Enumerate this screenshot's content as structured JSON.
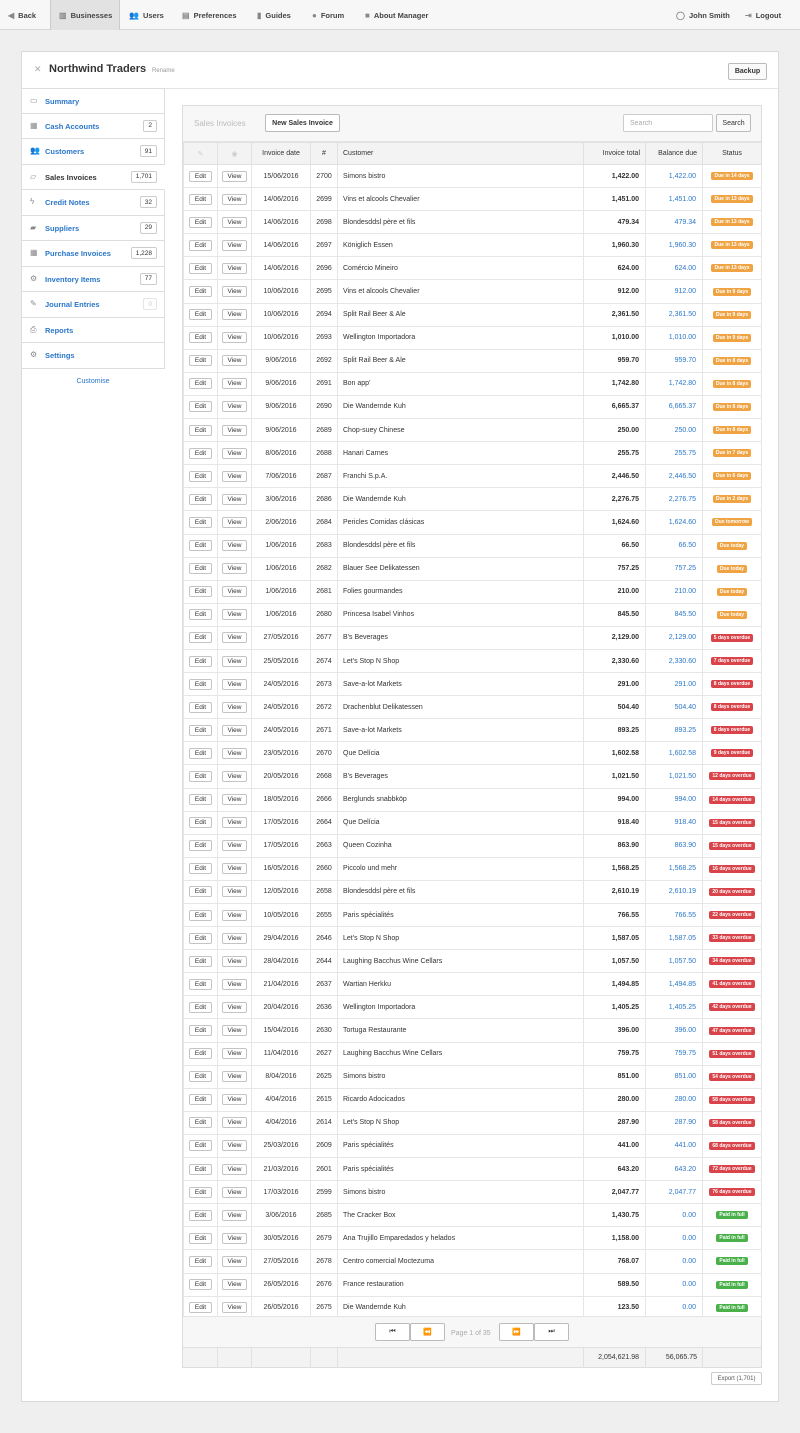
{
  "nav": {
    "back": "Back",
    "businesses": "Businesses",
    "users": "Users",
    "preferences": "Preferences",
    "guides": "Guides",
    "forum": "Forum",
    "about": "About Manager",
    "user": "John Smith",
    "logout": "Logout"
  },
  "business": {
    "name": "Northwind Traders",
    "rename": "Rename",
    "backup": "Backup"
  },
  "sidebar": {
    "items": [
      {
        "label": "Summary",
        "count": "",
        "icon": "monitor-icon"
      },
      {
        "label": "Cash Accounts",
        "count": "2",
        "icon": "cash-icon"
      },
      {
        "label": "Customers",
        "count": "91",
        "icon": "people-icon"
      },
      {
        "label": "Sales Invoices",
        "count": "1,701",
        "icon": "inbox-icon"
      },
      {
        "label": "Credit Notes",
        "count": "32",
        "icon": "bolt-icon"
      },
      {
        "label": "Suppliers",
        "count": "29",
        "icon": "truck-icon"
      },
      {
        "label": "Purchase Invoices",
        "count": "1,228",
        "icon": "calendar-icon"
      },
      {
        "label": "Inventory Items",
        "count": "77",
        "icon": "gears-icon"
      },
      {
        "label": "Journal Entries",
        "count": "0",
        "icon": "pen-icon"
      },
      {
        "label": "Reports",
        "count": "",
        "icon": "printer-icon"
      },
      {
        "label": "Settings",
        "count": "",
        "icon": "gear-icon"
      }
    ],
    "customise": "Customise"
  },
  "invoices": {
    "title": "Sales Invoices",
    "new_button": "New Sales Invoice",
    "search_placeholder": "Search",
    "search_button": "Search",
    "columns": {
      "date": "Invoice date",
      "num": "#",
      "customer": "Customer",
      "total": "Invoice total",
      "balance": "Balance due",
      "status": "Status"
    },
    "edit_label": "Edit",
    "view_label": "View",
    "rows": [
      [
        "15/06/2016",
        "2700",
        "Simons bistro",
        "1,422.00",
        "1,422.00",
        "Due in 14 days",
        "due"
      ],
      [
        "14/06/2016",
        "2699",
        "Vins et alcools Chevalier",
        "1,451.00",
        "1,451.00",
        "Due in 13 days",
        "due"
      ],
      [
        "14/06/2016",
        "2698",
        "Blondesddsl père et fils",
        "479.34",
        "479.34",
        "Due in 13 days",
        "due"
      ],
      [
        "14/06/2016",
        "2697",
        "Königlich Essen",
        "1,960.30",
        "1,960.30",
        "Due in 13 days",
        "due"
      ],
      [
        "14/06/2016",
        "2696",
        "Comércio Mineiro",
        "624.00",
        "624.00",
        "Due in 13 days",
        "due"
      ],
      [
        "10/06/2016",
        "2695",
        "Vins et alcools Chevalier",
        "912.00",
        "912.00",
        "Due in 9 days",
        "due"
      ],
      [
        "10/06/2016",
        "2694",
        "Split Rail Beer & Ale",
        "2,361.50",
        "2,361.50",
        "Due in 9 days",
        "due"
      ],
      [
        "10/06/2016",
        "2693",
        "Wellington Importadora",
        "1,010.00",
        "1,010.00",
        "Due in 9 days",
        "due"
      ],
      [
        "9/06/2016",
        "2692",
        "Split Rail Beer & Ale",
        "959.70",
        "959.70",
        "Due in 8 days",
        "due"
      ],
      [
        "9/06/2016",
        "2691",
        "Bon app'",
        "1,742.80",
        "1,742.80",
        "Due in 8 days",
        "due"
      ],
      [
        "9/06/2016",
        "2690",
        "Die Wandernde Kuh",
        "6,665.37",
        "6,665.37",
        "Due in 8 days",
        "due"
      ],
      [
        "9/06/2016",
        "2689",
        "Chop-suey Chinese",
        "250.00",
        "250.00",
        "Due in 8 days",
        "due"
      ],
      [
        "8/06/2016",
        "2688",
        "Hanari Carnes",
        "255.75",
        "255.75",
        "Due in 7 days",
        "due"
      ],
      [
        "7/06/2016",
        "2687",
        "Franchi S.p.A.",
        "2,446.50",
        "2,446.50",
        "Due in 6 days",
        "due"
      ],
      [
        "3/06/2016",
        "2686",
        "Die Wandernde Kuh",
        "2,276.75",
        "2,276.75",
        "Due in 2 days",
        "due"
      ],
      [
        "2/06/2016",
        "2684",
        "Pericles Comidas clásicas",
        "1,624.60",
        "1,624.60",
        "Due tomorrow",
        "due"
      ],
      [
        "1/06/2016",
        "2683",
        "Blondesddsl père et fils",
        "66.50",
        "66.50",
        "Due today",
        "due"
      ],
      [
        "1/06/2016",
        "2682",
        "Blauer See Delikatessen",
        "757.25",
        "757.25",
        "Due today",
        "due"
      ],
      [
        "1/06/2016",
        "2681",
        "Folies gourmandes",
        "210.00",
        "210.00",
        "Due today",
        "due"
      ],
      [
        "1/06/2016",
        "2680",
        "Princesa Isabel Vinhos",
        "845.50",
        "845.50",
        "Due today",
        "due"
      ],
      [
        "27/05/2016",
        "2677",
        "B's Beverages",
        "2,129.00",
        "2,129.00",
        "5 days overdue",
        "overdue"
      ],
      [
        "25/05/2016",
        "2674",
        "Let's Stop N Shop",
        "2,330.60",
        "2,330.60",
        "7 days overdue",
        "overdue"
      ],
      [
        "24/05/2016",
        "2673",
        "Save-a-lot Markets",
        "291.00",
        "291.00",
        "8 days overdue",
        "overdue"
      ],
      [
        "24/05/2016",
        "2672",
        "Drachenblut Delikatessen",
        "504.40",
        "504.40",
        "8 days overdue",
        "overdue"
      ],
      [
        "24/05/2016",
        "2671",
        "Save-a-lot Markets",
        "893.25",
        "893.25",
        "8 days overdue",
        "overdue"
      ],
      [
        "23/05/2016",
        "2670",
        "Que Delícia",
        "1,602.58",
        "1,602.58",
        "9 days overdue",
        "overdue"
      ],
      [
        "20/05/2016",
        "2668",
        "B's Beverages",
        "1,021.50",
        "1,021.50",
        "12 days overdue",
        "overdue"
      ],
      [
        "18/05/2016",
        "2666",
        "Berglunds snabbköp",
        "994.00",
        "994.00",
        "14 days overdue",
        "overdue"
      ],
      [
        "17/05/2016",
        "2664",
        "Que Delícia",
        "918.40",
        "918.40",
        "15 days overdue",
        "overdue"
      ],
      [
        "17/05/2016",
        "2663",
        "Queen Cozinha",
        "863.90",
        "863.90",
        "15 days overdue",
        "overdue"
      ],
      [
        "16/05/2016",
        "2660",
        "Piccolo und mehr",
        "1,568.25",
        "1,568.25",
        "16 days overdue",
        "overdue"
      ],
      [
        "12/05/2016",
        "2658",
        "Blondesddsl père et fils",
        "2,610.19",
        "2,610.19",
        "20 days overdue",
        "overdue"
      ],
      [
        "10/05/2016",
        "2655",
        "Paris spécialités",
        "766.55",
        "766.55",
        "22 days overdue",
        "overdue"
      ],
      [
        "29/04/2016",
        "2646",
        "Let's Stop N Shop",
        "1,587.05",
        "1,587.05",
        "33 days overdue",
        "overdue"
      ],
      [
        "28/04/2016",
        "2644",
        "Laughing Bacchus Wine Cellars",
        "1,057.50",
        "1,057.50",
        "34 days overdue",
        "overdue"
      ],
      [
        "21/04/2016",
        "2637",
        "Wartian Herkku",
        "1,494.85",
        "1,494.85",
        "41 days overdue",
        "overdue"
      ],
      [
        "20/04/2016",
        "2636",
        "Wellington Importadora",
        "1,405.25",
        "1,405.25",
        "42 days overdue",
        "overdue"
      ],
      [
        "15/04/2016",
        "2630",
        "Tortuga Restaurante",
        "396.00",
        "396.00",
        "47 days overdue",
        "overdue"
      ],
      [
        "11/04/2016",
        "2627",
        "Laughing Bacchus Wine Cellars",
        "759.75",
        "759.75",
        "51 days overdue",
        "overdue"
      ],
      [
        "8/04/2016",
        "2625",
        "Simons bistro",
        "851.00",
        "851.00",
        "54 days overdue",
        "overdue"
      ],
      [
        "4/04/2016",
        "2615",
        "Ricardo Adocicados",
        "280.00",
        "280.00",
        "58 days overdue",
        "overdue"
      ],
      [
        "4/04/2016",
        "2614",
        "Let's Stop N Shop",
        "287.90",
        "287.90",
        "58 days overdue",
        "overdue"
      ],
      [
        "25/03/2016",
        "2609",
        "Paris spécialités",
        "441.00",
        "441.00",
        "68 days overdue",
        "overdue"
      ],
      [
        "21/03/2016",
        "2601",
        "Paris spécialités",
        "643.20",
        "643.20",
        "72 days overdue",
        "overdue"
      ],
      [
        "17/03/2016",
        "2599",
        "Simons bistro",
        "2,047.77",
        "2,047.77",
        "76 days overdue",
        "overdue"
      ],
      [
        "3/06/2016",
        "2685",
        "The Cracker Box",
        "1,430.75",
        "0.00",
        "Paid in full",
        "paid"
      ],
      [
        "30/05/2016",
        "2679",
        "Ana Trujillo Emparedados y helados",
        "1,158.00",
        "0.00",
        "Paid in full",
        "paid"
      ],
      [
        "27/05/2016",
        "2678",
        "Centro comercial Moctezuma",
        "768.07",
        "0.00",
        "Paid in full",
        "paid"
      ],
      [
        "26/05/2016",
        "2676",
        "France restauration",
        "589.50",
        "0.00",
        "Paid in full",
        "paid"
      ],
      [
        "26/05/2016",
        "2675",
        "Die Wandernde Kuh",
        "123.50",
        "0.00",
        "Paid in full",
        "paid"
      ]
    ],
    "page_info": "Page 1 of 35",
    "total_sum": "2,054,621.98",
    "balance_sum": "56,065.75",
    "export": "Export (1,701)"
  },
  "colors": {
    "due": "#f0a342",
    "overdue": "#d9434a",
    "paid": "#4ab14a",
    "link": "#2a77c9"
  }
}
